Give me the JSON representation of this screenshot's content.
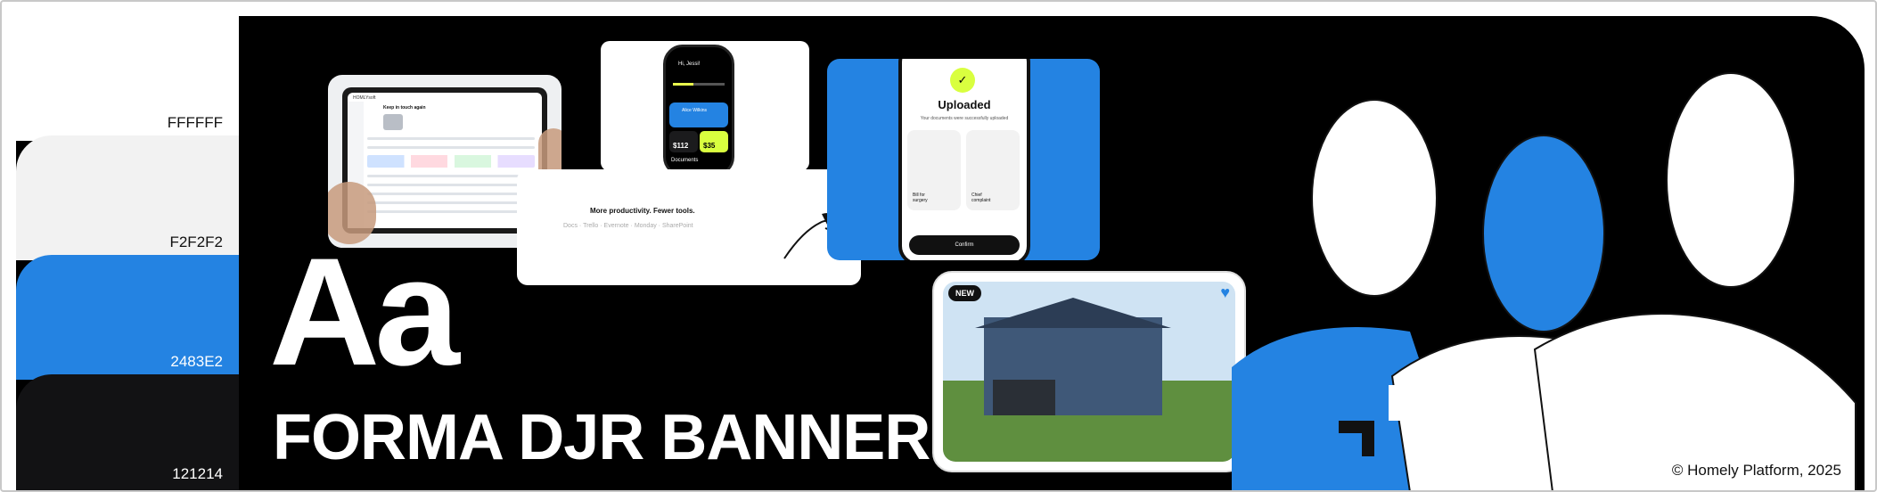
{
  "palette": [
    {
      "label": "FFFFFF",
      "color": "#FFFFFF"
    },
    {
      "label": "F2F2F2",
      "color": "#F2F2F2"
    },
    {
      "label": "2483E2",
      "color": "#2483E2"
    },
    {
      "label": "121214",
      "color": "#121214"
    }
  ],
  "typography": {
    "specimen": "Aa"
  },
  "banner": {
    "title": "FORMA DJR BANNER",
    "copyright": "© Homely Platform, 2025"
  },
  "mockups": {
    "tablet": {
      "app_name": "HOMLYsoft",
      "heading": "Keep in touch again"
    },
    "phone_dashboard": {
      "greeting": "Hi, Jessi!",
      "card_name": "Alice Wilkins",
      "amount_a": "$112",
      "amount_b": "$35",
      "section": "Documents"
    },
    "tagline": {
      "text": "More productivity. Fewer tools.",
      "tools": [
        "Docs",
        "Trello",
        "Evernote",
        "Monday",
        "SharePoint"
      ]
    },
    "upload": {
      "title": "Uploaded",
      "subtitle": "Your documents were successfully uploaded",
      "doc_a": "Bill for surgery",
      "doc_b": "Chief complaint",
      "confirm": "Confirm"
    },
    "listing": {
      "badge": "NEW"
    }
  },
  "accent": "#2483E2"
}
